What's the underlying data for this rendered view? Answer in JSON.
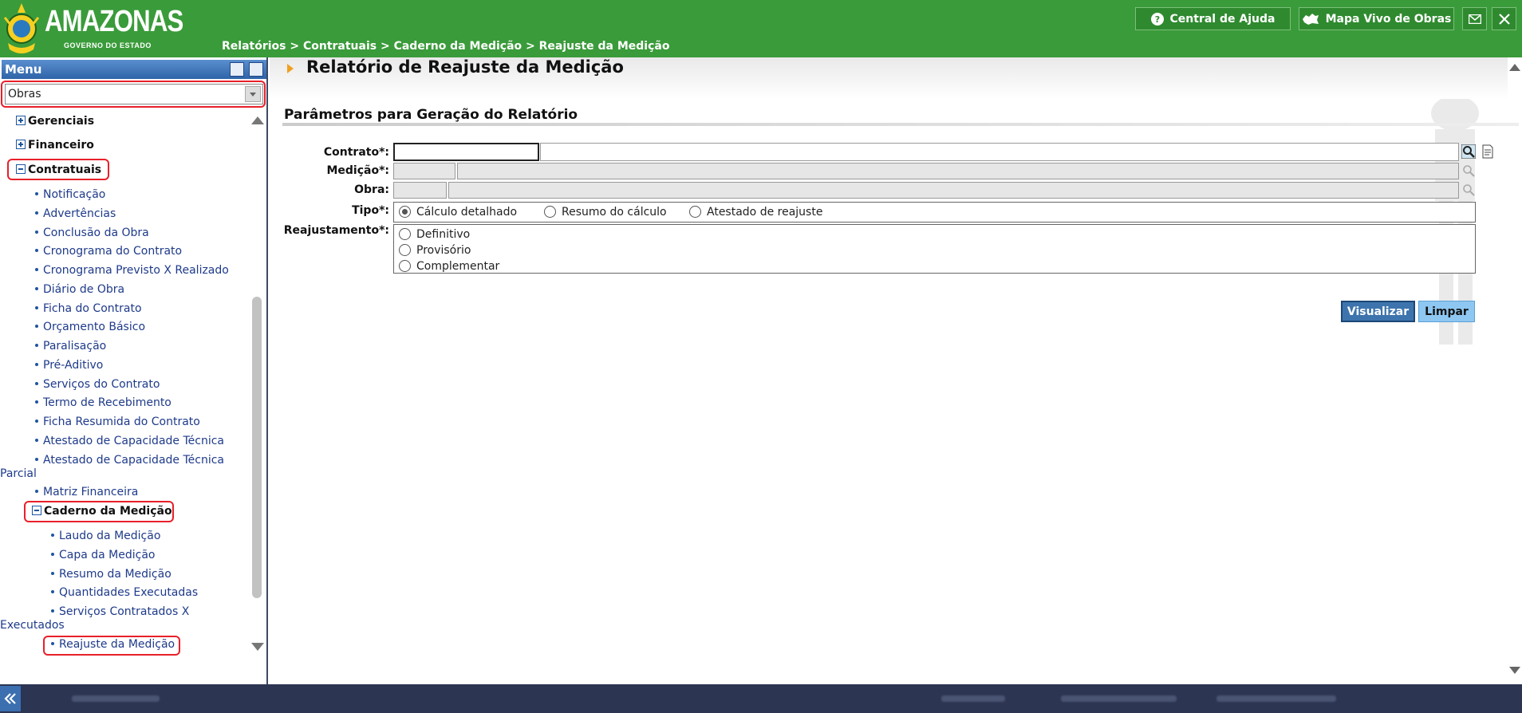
{
  "header": {
    "brand": "AMAZONAS",
    "brand_sub": "GOVERNO DO ESTADO",
    "breadcrumb": "Relatórios > Contratuais > Caderno da Medição > Reajuste da Medição",
    "help_label": "Central de Ajuda",
    "map_label": "Mapa Vivo de Obras"
  },
  "sidebar": {
    "menu_title": "Menu",
    "module": "Obras",
    "groups": {
      "gerenciais": "Gerenciais",
      "financeiro": "Financeiro",
      "contratuais": "Contratuais",
      "caderno": "Caderno da Medição"
    },
    "contratuais_items": [
      "Notificação",
      "Advertências",
      "Conclusão da Obra",
      "Cronograma do Contrato",
      "Cronograma Previsto X Realizado",
      "Diário de Obra",
      "Ficha do Contrato",
      "Orçamento Básico",
      "Paralisação",
      "Pré-Aditivo",
      "Serviços do Contrato",
      "Termo de Recebimento",
      "Ficha Resumida do Contrato",
      "Atestado de Capacidade Técnica",
      "Atestado de Capacidade Técnica Parcial",
      "Matriz Financeira"
    ],
    "caderno_items": [
      "Laudo da Medição",
      "Capa da Medição",
      "Resumo da Medição",
      "Quantidades Executadas",
      "Serviços Contratados X Executados",
      "Reajuste da Medição"
    ]
  },
  "main": {
    "page_title": "Relatório de Reajuste da Medição",
    "section_title": "Parâmetros para Geração do Relatório",
    "fields": {
      "contrato_label": "Contrato*:",
      "medicao_label": "Medição*:",
      "obra_label": "Obra:",
      "tipo_label": "Tipo*:",
      "reajustamento_label": "Reajustamento*:"
    },
    "tipo_options": [
      "Cálculo detalhado",
      "Resumo do cálculo",
      "Atestado de reajuste"
    ],
    "tipo_selected": "Cálculo detalhado",
    "reajustamento_options": [
      "Definitivo",
      "Provisório",
      "Complementar"
    ],
    "buttons": {
      "visualizar": "Visualizar",
      "limpar": "Limpar"
    }
  },
  "colors": {
    "header_green": "#3a9b3a",
    "footer_navy": "#2c3552",
    "highlight_red": "#e8202a",
    "primary_button": "#3e74ad"
  }
}
